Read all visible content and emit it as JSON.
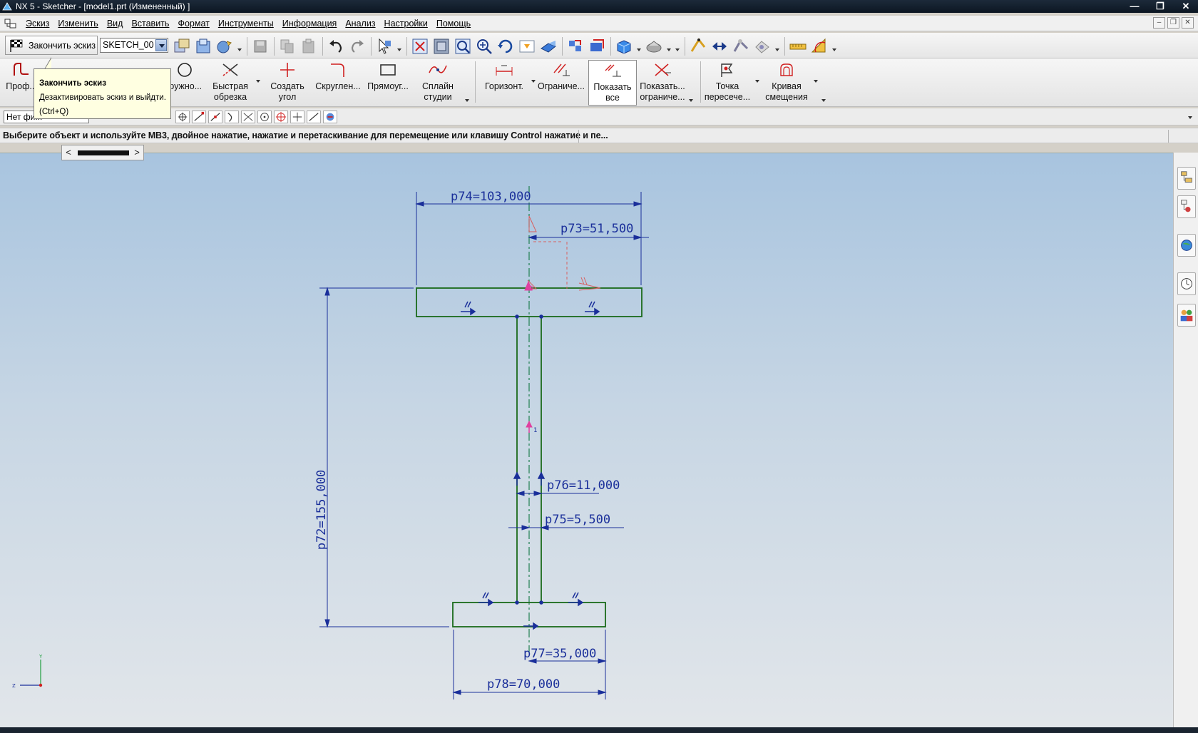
{
  "window": {
    "title": "NX 5 - Sketcher - [model1.prt (Измененный) ]",
    "controls": [
      "minimize",
      "restore",
      "close"
    ]
  },
  "menubar": {
    "items": [
      "Эскиз",
      "Изменить",
      "Вид",
      "Вставить",
      "Формат",
      "Инструменты",
      "Информация",
      "Анализ",
      "Настройки",
      "Помощь"
    ]
  },
  "toolbar1": {
    "finish_label": "Закончить эскиз",
    "sketch_name": "SKETCH_00"
  },
  "toolbar2": {
    "buttons": [
      {
        "label": "Проф..."
      },
      {
        "label": "...ружно..."
      },
      {
        "label": "Быстрая обрезка",
        "line1": "Быстрая",
        "line2": "обрезка"
      },
      {
        "label": "Создать угол",
        "line1": "Создать",
        "line2": "угол"
      },
      {
        "label": "Скруглен..."
      },
      {
        "label": "Прямоуг..."
      },
      {
        "label": "Сплайн студии",
        "line1": "Сплайн",
        "line2": "студии"
      },
      {
        "label": "Горизонт."
      },
      {
        "label": "Ограниче..."
      },
      {
        "label": "Показать все",
        "line1": "Показать",
        "line2": "все"
      },
      {
        "label": "Показать ограниче...",
        "line1": "Показать...",
        "line2": "ограниче..."
      },
      {
        "label": "Точка пересече...",
        "line1": "Точка",
        "line2": "пересече..."
      },
      {
        "label": "Кривая смещения",
        "line1": "Кривая",
        "line2": "смещения"
      }
    ]
  },
  "toolbar3": {
    "filter_value": "Нет фи..."
  },
  "status": {
    "prompt": "Выберите объект и используйте МВ3, двойное нажатие, нажатие и перетаскивание для перемещение или клавишу Control нажатие и пе..."
  },
  "tooltip": {
    "title": "Закончить эскиз",
    "description": "Дезактивировать эскиз и выйдти.",
    "shortcut": "(Ctrl+Q)"
  },
  "sketch": {
    "dimensions": {
      "p74": "p74=103,000",
      "p73": "p73=51,500",
      "p72": "p72=155,000",
      "p76": "p76=11,000",
      "p75": "p75=5,500",
      "p77": "p77=35,000",
      "p78": "p78=70,000"
    },
    "axis": {
      "y": "Y",
      "z": "Z"
    },
    "marker_label": "1"
  },
  "colors": {
    "geometry": "#1a6a1a",
    "dimension": "#1a2f9a",
    "constraint": "#d86060",
    "centerline": "#1f7f4f"
  }
}
